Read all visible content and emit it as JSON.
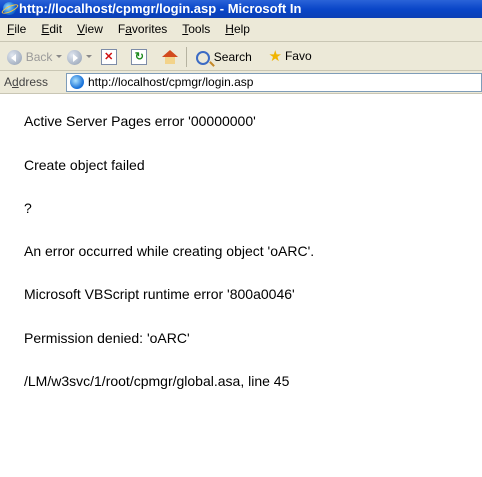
{
  "window": {
    "title": "http://localhost/cpmgr/login.asp - Microsoft In"
  },
  "menu": {
    "items": [
      {
        "label": "File"
      },
      {
        "label": "Edit"
      },
      {
        "label": "View"
      },
      {
        "label": "Favorites"
      },
      {
        "label": "Tools"
      },
      {
        "label": "Help"
      }
    ]
  },
  "toolbar": {
    "back_label": "Back",
    "search_label": "Search",
    "favorites_label": "Favo"
  },
  "address_bar": {
    "label": "Address",
    "url": "http://localhost/cpmgr/login.asp"
  },
  "content": {
    "lines": [
      "Active Server Pages error '00000000'",
      "Create object failed",
      "?",
      "An error occurred while creating object 'oARC'.",
      "Microsoft VBScript runtime error '800a0046'",
      "Permission denied: 'oARC'",
      "/LM/w3svc/1/root/cpmgr/global.asa, line 45"
    ]
  }
}
